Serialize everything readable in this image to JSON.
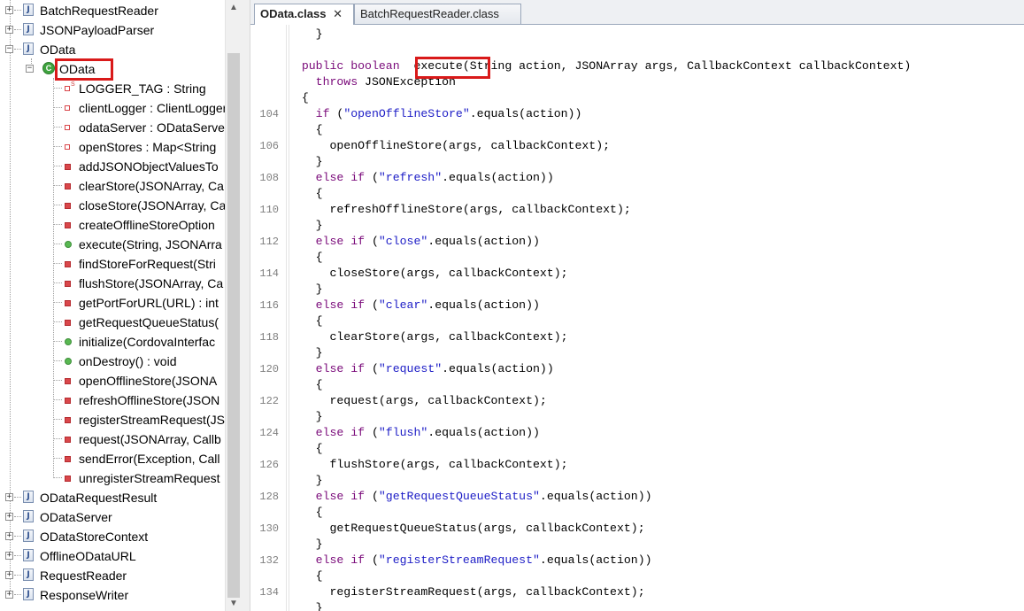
{
  "tree": {
    "items": [
      {
        "label": "BatchRequestReader",
        "kind": "java-file"
      },
      {
        "label": "JSONPayloadParser",
        "kind": "java-file"
      },
      {
        "label": "OData",
        "kind": "java-file"
      },
      {
        "label": "OData",
        "kind": "class"
      },
      {
        "label": "LOGGER_TAG : String",
        "kind": "field-static"
      },
      {
        "label": "clientLogger : ClientLogger",
        "kind": "field-private"
      },
      {
        "label": "odataServer : ODataServer",
        "kind": "field-private"
      },
      {
        "label": "openStores : Map<String",
        "kind": "field-private"
      },
      {
        "label": "addJSONObjectValuesTo",
        "kind": "method-private"
      },
      {
        "label": "clearStore(JSONArray, Ca",
        "kind": "method-private"
      },
      {
        "label": "closeStore(JSONArray, Ca",
        "kind": "method-private"
      },
      {
        "label": "createOfflineStoreOption",
        "kind": "method-private"
      },
      {
        "label": "execute(String, JSONArra",
        "kind": "method-public"
      },
      {
        "label": "findStoreForRequest(Stri",
        "kind": "method-private"
      },
      {
        "label": "flushStore(JSONArray, Ca",
        "kind": "method-private"
      },
      {
        "label": "getPortForURL(URL) : int",
        "kind": "method-private"
      },
      {
        "label": "getRequestQueueStatus(",
        "kind": "method-private"
      },
      {
        "label": "initialize(CordovaInterfac",
        "kind": "method-public"
      },
      {
        "label": "onDestroy() : void",
        "kind": "method-public"
      },
      {
        "label": "openOfflineStore(JSONA",
        "kind": "method-private"
      },
      {
        "label": "refreshOfflineStore(JSON",
        "kind": "method-private"
      },
      {
        "label": "registerStreamRequest(JS",
        "kind": "method-private"
      },
      {
        "label": "request(JSONArray, Callb",
        "kind": "method-private"
      },
      {
        "label": "sendError(Exception, Call",
        "kind": "method-private"
      },
      {
        "label": "unregisterStreamRequest",
        "kind": "method-private"
      },
      {
        "label": "ODataRequestResult",
        "kind": "java-file"
      },
      {
        "label": "ODataServer",
        "kind": "java-file"
      },
      {
        "label": "ODataStoreContext",
        "kind": "java-file"
      },
      {
        "label": "OfflineODataURL",
        "kind": "java-file"
      },
      {
        "label": "RequestReader",
        "kind": "java-file"
      },
      {
        "label": "ResponseWriter",
        "kind": "java-file"
      }
    ],
    "highlight_color": "#d91a1a"
  },
  "tabs": [
    {
      "label": "OData.class",
      "close": "✕",
      "active": true
    },
    {
      "label": "BatchRequestReader.class",
      "close": "",
      "active": false
    }
  ],
  "code": {
    "lines": [
      {
        "num": "",
        "tokens": [
          {
            "t": "    }",
            "c": ""
          }
        ]
      },
      {
        "num": "",
        "tokens": []
      },
      {
        "num": "",
        "tokens": [
          {
            "t": "  public boolean",
            "c": "kw"
          },
          {
            "t": "  execute(String action, JSONArray args, CallbackContext callbackContext)",
            "c": ""
          }
        ]
      },
      {
        "num": "",
        "tokens": [
          {
            "t": "    throws",
            "c": "kw"
          },
          {
            "t": " JSONException",
            "c": ""
          }
        ]
      },
      {
        "num": "",
        "tokens": [
          {
            "t": "  {",
            "c": ""
          }
        ]
      },
      {
        "num": "104",
        "tokens": [
          {
            "t": "    if",
            "c": "kw"
          },
          {
            "t": " (",
            "c": ""
          },
          {
            "t": "\"openOfflineStore\"",
            "c": "str"
          },
          {
            "t": ".equals(action))",
            "c": ""
          }
        ]
      },
      {
        "num": "",
        "tokens": [
          {
            "t": "    {",
            "c": ""
          }
        ]
      },
      {
        "num": "106",
        "tokens": [
          {
            "t": "      openOfflineStore(args, callbackContext);",
            "c": ""
          }
        ]
      },
      {
        "num": "",
        "tokens": [
          {
            "t": "    }",
            "c": ""
          }
        ]
      },
      {
        "num": "108",
        "tokens": [
          {
            "t": "    else if",
            "c": "kw"
          },
          {
            "t": " (",
            "c": ""
          },
          {
            "t": "\"refresh\"",
            "c": "str"
          },
          {
            "t": ".equals(action))",
            "c": ""
          }
        ]
      },
      {
        "num": "",
        "tokens": [
          {
            "t": "    {",
            "c": ""
          }
        ]
      },
      {
        "num": "110",
        "tokens": [
          {
            "t": "      refreshOfflineStore(args, callbackContext);",
            "c": ""
          }
        ]
      },
      {
        "num": "",
        "tokens": [
          {
            "t": "    }",
            "c": ""
          }
        ]
      },
      {
        "num": "112",
        "tokens": [
          {
            "t": "    else if",
            "c": "kw"
          },
          {
            "t": " (",
            "c": ""
          },
          {
            "t": "\"close\"",
            "c": "str"
          },
          {
            "t": ".equals(action))",
            "c": ""
          }
        ]
      },
      {
        "num": "",
        "tokens": [
          {
            "t": "    {",
            "c": ""
          }
        ]
      },
      {
        "num": "114",
        "tokens": [
          {
            "t": "      closeStore(args, callbackContext);",
            "c": ""
          }
        ]
      },
      {
        "num": "",
        "tokens": [
          {
            "t": "    }",
            "c": ""
          }
        ]
      },
      {
        "num": "116",
        "tokens": [
          {
            "t": "    else if",
            "c": "kw"
          },
          {
            "t": " (",
            "c": ""
          },
          {
            "t": "\"clear\"",
            "c": "str"
          },
          {
            "t": ".equals(action))",
            "c": ""
          }
        ]
      },
      {
        "num": "",
        "tokens": [
          {
            "t": "    {",
            "c": ""
          }
        ]
      },
      {
        "num": "118",
        "tokens": [
          {
            "t": "      clearStore(args, callbackContext);",
            "c": ""
          }
        ]
      },
      {
        "num": "",
        "tokens": [
          {
            "t": "    }",
            "c": ""
          }
        ]
      },
      {
        "num": "120",
        "tokens": [
          {
            "t": "    else if",
            "c": "kw"
          },
          {
            "t": " (",
            "c": ""
          },
          {
            "t": "\"request\"",
            "c": "str"
          },
          {
            "t": ".equals(action))",
            "c": ""
          }
        ]
      },
      {
        "num": "",
        "tokens": [
          {
            "t": "    {",
            "c": ""
          }
        ]
      },
      {
        "num": "122",
        "tokens": [
          {
            "t": "      request(args, callbackContext);",
            "c": ""
          }
        ]
      },
      {
        "num": "",
        "tokens": [
          {
            "t": "    }",
            "c": ""
          }
        ]
      },
      {
        "num": "124",
        "tokens": [
          {
            "t": "    else if",
            "c": "kw"
          },
          {
            "t": " (",
            "c": ""
          },
          {
            "t": "\"flush\"",
            "c": "str"
          },
          {
            "t": ".equals(action))",
            "c": ""
          }
        ]
      },
      {
        "num": "",
        "tokens": [
          {
            "t": "    {",
            "c": ""
          }
        ]
      },
      {
        "num": "126",
        "tokens": [
          {
            "t": "      flushStore(args, callbackContext);",
            "c": ""
          }
        ]
      },
      {
        "num": "",
        "tokens": [
          {
            "t": "    }",
            "c": ""
          }
        ]
      },
      {
        "num": "128",
        "tokens": [
          {
            "t": "    else if",
            "c": "kw"
          },
          {
            "t": " (",
            "c": ""
          },
          {
            "t": "\"getRequestQueueStatus\"",
            "c": "str"
          },
          {
            "t": ".equals(action))",
            "c": ""
          }
        ]
      },
      {
        "num": "",
        "tokens": [
          {
            "t": "    {",
            "c": ""
          }
        ]
      },
      {
        "num": "130",
        "tokens": [
          {
            "t": "      getRequestQueueStatus(args, callbackContext);",
            "c": ""
          }
        ]
      },
      {
        "num": "",
        "tokens": [
          {
            "t": "    }",
            "c": ""
          }
        ]
      },
      {
        "num": "132",
        "tokens": [
          {
            "t": "    else if",
            "c": "kw"
          },
          {
            "t": " (",
            "c": ""
          },
          {
            "t": "\"registerStreamRequest\"",
            "c": "str"
          },
          {
            "t": ".equals(action))",
            "c": ""
          }
        ]
      },
      {
        "num": "",
        "tokens": [
          {
            "t": "    {",
            "c": ""
          }
        ]
      },
      {
        "num": "134",
        "tokens": [
          {
            "t": "      registerStreamRequest(args, callbackContext);",
            "c": ""
          }
        ]
      },
      {
        "num": "",
        "tokens": [
          {
            "t": "    }",
            "c": ""
          }
        ]
      }
    ],
    "keyword_color": "#7a0a7a",
    "string_color": "#1c1cc6"
  }
}
